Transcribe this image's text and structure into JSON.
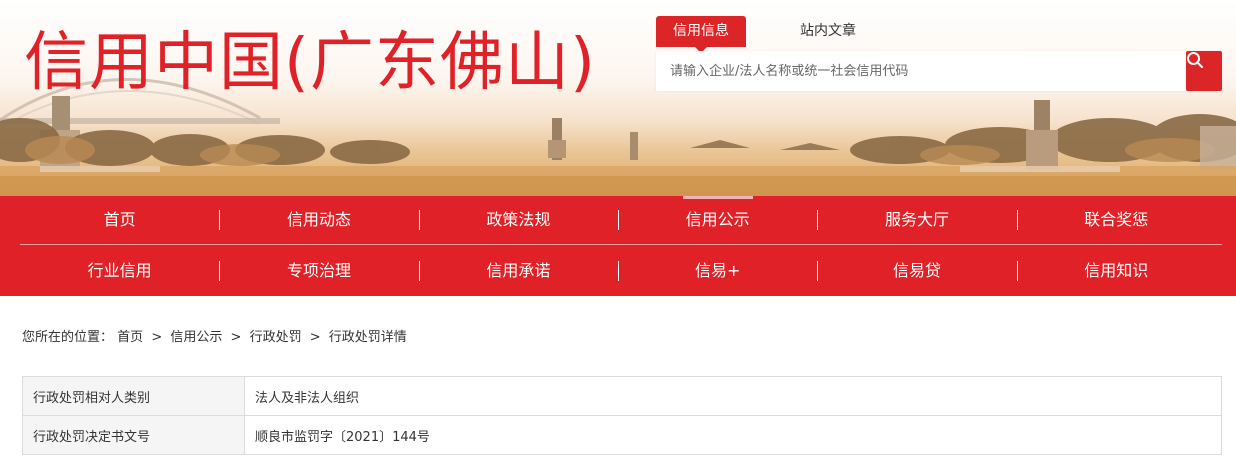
{
  "banner": {
    "site_title": "信用中国(广东佛山)"
  },
  "search": {
    "tabs": [
      {
        "label": "信用信息",
        "active": true
      },
      {
        "label": "站内文章",
        "active": false
      }
    ],
    "placeholder": "请输入企业/法人名称或统一社会信用代码",
    "button_icon": "search-icon"
  },
  "nav": {
    "row1": [
      "首页",
      "信用动态",
      "政策法规",
      "信用公示",
      "服务大厅",
      "联合奖惩"
    ],
    "row2": [
      "行业信用",
      "专项治理",
      "信用承诺",
      "信易+",
      "信易贷",
      "信用知识"
    ],
    "current": "信用公示"
  },
  "breadcrumb": {
    "prefix": "您所在的位置：",
    "items": [
      "首页",
      "信用公示",
      "行政处罚",
      "行政处罚详情"
    ],
    "separator": ">"
  },
  "detail": {
    "rows": [
      {
        "label": "行政处罚相对人类别",
        "value": "法人及非法人组织"
      },
      {
        "label": "行政处罚决定书文号",
        "value": "顺良市监罚字〔2021〕144号"
      }
    ]
  },
  "colors": {
    "brand_red": "#e02127",
    "title_red": "#e02228"
  }
}
